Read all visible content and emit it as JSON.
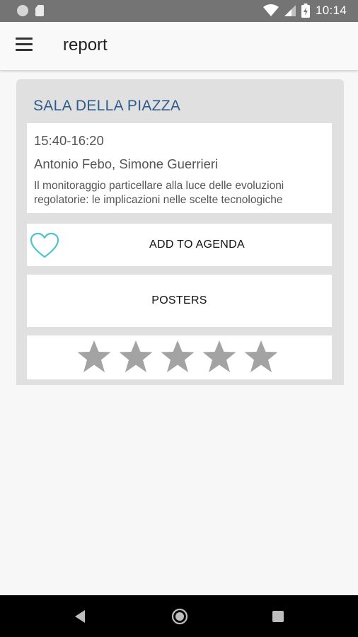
{
  "status_bar": {
    "time": "10:14"
  },
  "app_bar": {
    "title": "report"
  },
  "card": {
    "room": "SALA DELLA PIAZZA",
    "session": {
      "time": "15:40-16:20",
      "speakers": "Antonio Febo, Simone Guerrieri",
      "abstract": "Il monitoraggio particellare alla luce delle evoluzioni regolatorie: le implicazioni nelle scelte tecnologiche"
    },
    "agenda_label": "ADD TO AGENDA",
    "posters_label": "POSTERS",
    "rating": {
      "value": 0,
      "max": 5
    }
  },
  "colors": {
    "accent_heart": "#4cc3cf",
    "room_title": "#2f5b8a",
    "star_empty": "#a3a3a3"
  },
  "icons": {
    "menu": "hamburger-icon",
    "agenda": "heart-icon",
    "rating": "star-icon",
    "nav": [
      "back-icon",
      "home-icon",
      "recents-icon"
    ]
  }
}
